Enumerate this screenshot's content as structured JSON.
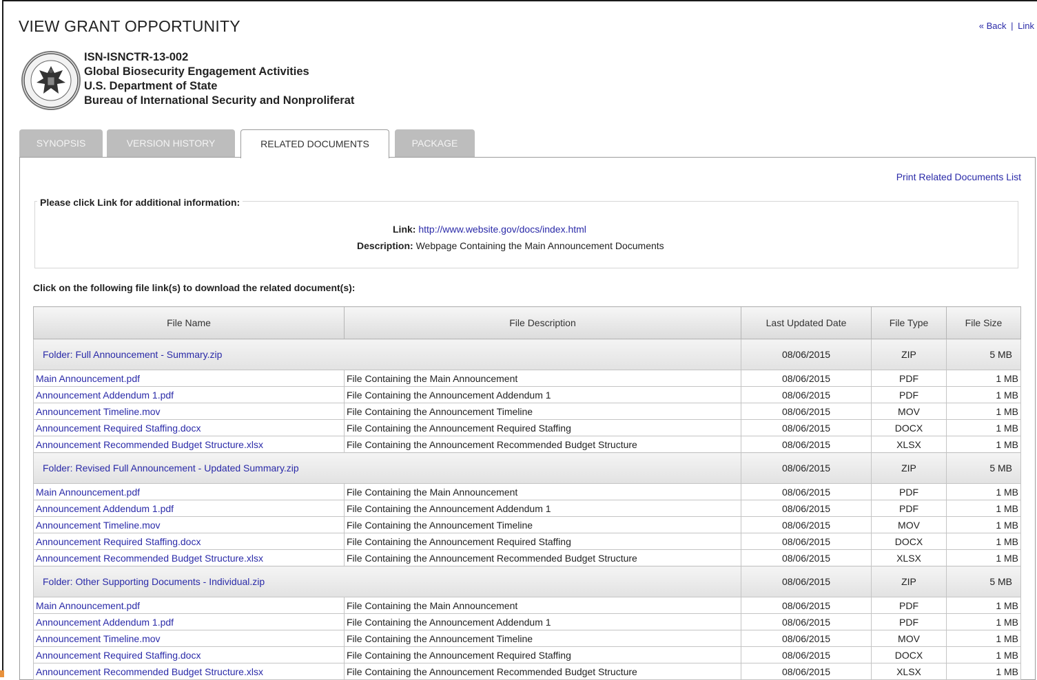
{
  "page": {
    "title": "VIEW GRANT OPPORTUNITY",
    "back_link": "« Back",
    "link_link": "Link",
    "separator": "|"
  },
  "header": {
    "seal_icon": "department-of-state-seal",
    "opportunity_number": "ISN-ISNCTR-13-002",
    "opportunity_title": "Global Biosecurity Engagement Activities",
    "agency": "U.S. Department of State",
    "bureau": "Bureau of International Security and Nonproliferat"
  },
  "tabs": [
    {
      "label": "SYNOPSIS",
      "active": false
    },
    {
      "label": "VERSION HISTORY",
      "active": false
    },
    {
      "label": "RELATED DOCUMENTS",
      "active": true
    },
    {
      "label": "PACKAGE",
      "active": false
    }
  ],
  "related": {
    "print_link": "Print Related Documents List",
    "legend": "Please click Link for additional information:",
    "link_label": "Link:",
    "link_url": "http://www.website.gov/docs/index.html",
    "description_label": "Description:",
    "description_text": "Webpage Containing the Main Announcement Documents",
    "instruction": "Click on the following file link(s) to download the related document(s):"
  },
  "table": {
    "headers": [
      "File Name",
      "File Description",
      "Last Updated Date",
      "File Type",
      "File Size"
    ],
    "folders": [
      {
        "name": "Folder: Full Announcement - Summary.zip",
        "date": "08/06/2015",
        "type": "ZIP",
        "size": "5 MB",
        "files": [
          {
            "name": "Main Announcement.pdf",
            "desc": "File Containing the Main Announcement",
            "date": "08/06/2015",
            "type": "PDF",
            "size": "1 MB"
          },
          {
            "name": "Announcement Addendum 1.pdf",
            "desc": "File Containing the Announcement Addendum 1",
            "date": "08/06/2015",
            "type": "PDF",
            "size": "1 MB"
          },
          {
            "name": "Announcement Timeline.mov",
            "desc": "File Containing the Announcement Timeline",
            "date": "08/06/2015",
            "type": "MOV",
            "size": "1 MB"
          },
          {
            "name": "Announcement Required Staffing.docx",
            "desc": "File Containing the Announcement Required Staffing",
            "date": "08/06/2015",
            "type": "DOCX",
            "size": "1 MB"
          },
          {
            "name": "Announcement Recommended Budget Structure.xlsx",
            "desc": "File Containing the Announcement Recommended Budget Structure",
            "date": "08/06/2015",
            "type": "XLSX",
            "size": "1 MB"
          }
        ]
      },
      {
        "name": "Folder: Revised Full Announcement - Updated Summary.zip",
        "date": "08/06/2015",
        "type": "ZIP",
        "size": "5 MB",
        "files": [
          {
            "name": "Main Announcement.pdf",
            "desc": "File Containing the Main Announcement",
            "date": "08/06/2015",
            "type": "PDF",
            "size": "1 MB"
          },
          {
            "name": "Announcement Addendum 1.pdf",
            "desc": "File Containing the Announcement Addendum 1",
            "date": "08/06/2015",
            "type": "PDF",
            "size": "1 MB"
          },
          {
            "name": "Announcement Timeline.mov",
            "desc": "File Containing the Announcement Timeline",
            "date": "08/06/2015",
            "type": "MOV",
            "size": "1 MB"
          },
          {
            "name": "Announcement Required Staffing.docx",
            "desc": "File Containing the Announcement Required Staffing",
            "date": "08/06/2015",
            "type": "DOCX",
            "size": "1 MB"
          },
          {
            "name": "Announcement Recommended Budget Structure.xlsx",
            "desc": "File Containing the Announcement Recommended Budget Structure",
            "date": "08/06/2015",
            "type": "XLSX",
            "size": "1 MB"
          }
        ]
      },
      {
        "name": "Folder: Other Supporting Documents - Individual.zip",
        "date": "08/06/2015",
        "type": "ZIP",
        "size": "5 MB",
        "files": [
          {
            "name": "Main Announcement.pdf",
            "desc": "File Containing the Main Announcement",
            "date": "08/06/2015",
            "type": "PDF",
            "size": "1 MB"
          },
          {
            "name": "Announcement Addendum 1.pdf",
            "desc": "File Containing the Announcement Addendum 1",
            "date": "08/06/2015",
            "type": "PDF",
            "size": "1 MB"
          },
          {
            "name": "Announcement Timeline.mov",
            "desc": "File Containing the Announcement Timeline",
            "date": "08/06/2015",
            "type": "MOV",
            "size": "1 MB"
          },
          {
            "name": "Announcement Required Staffing.docx",
            "desc": "File Containing the Announcement Required Staffing",
            "date": "08/06/2015",
            "type": "DOCX",
            "size": "1 MB"
          },
          {
            "name": "Announcement Recommended Budget Structure.xlsx",
            "desc": "File Containing the Announcement Recommended Budget Structure",
            "date": "08/06/2015",
            "type": "XLSX",
            "size": "1 MB"
          }
        ]
      }
    ]
  },
  "colors": {
    "link": "#2a2aa8",
    "tab_inactive": "#bdbdbd",
    "accent": "#e8913c"
  }
}
